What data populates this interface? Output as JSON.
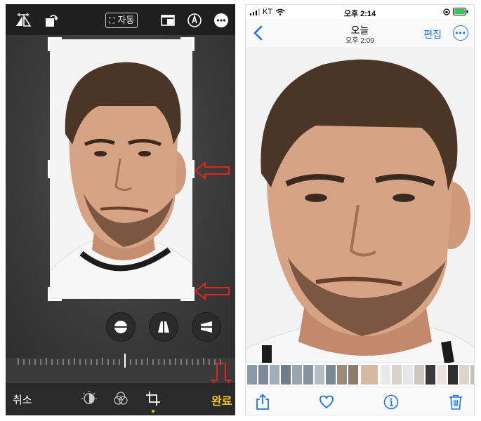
{
  "editor": {
    "auto_label": "자동",
    "cancel_label": "취소",
    "done_label": "완료",
    "icons": [
      "flip-icon",
      "rotate-icon",
      "aspect-ratio-icon",
      "markup-icon",
      "more-icon",
      "straighten-icon",
      "vertical-perspective-icon",
      "horizontal-perspective-icon",
      "adjust-icon",
      "filters-icon",
      "crop-icon"
    ],
    "annotation_color": "#e0241b",
    "done_color": "#f5c518"
  },
  "viewer": {
    "status": {
      "carrier": "KT",
      "time": "오후 2:14"
    },
    "nav": {
      "title": "오늘",
      "subtitle": "오후 2:09",
      "edit_label": "편집"
    },
    "icons": [
      "back-icon",
      "more-icon",
      "share-icon",
      "heart-icon",
      "info-icon",
      "trash-icon"
    ],
    "accent_color": "#1a73e8"
  }
}
